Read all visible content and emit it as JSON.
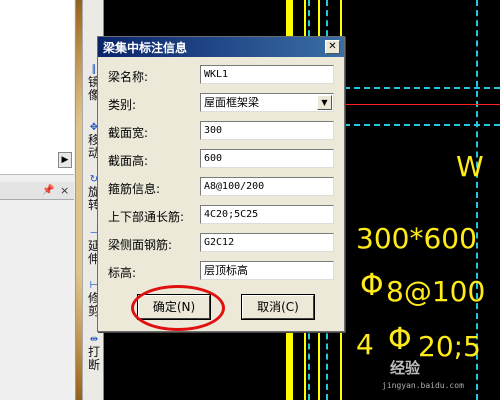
{
  "dialog": {
    "title": "梁集中标注信息",
    "close_label": "✕",
    "fields": [
      {
        "label": "梁名称:",
        "value": "WKL1"
      },
      {
        "label": "类别:",
        "value": "屋面框架梁"
      },
      {
        "label": "截面宽:",
        "value": "300"
      },
      {
        "label": "截面高:",
        "value": "600"
      },
      {
        "label": "箍筋信息:",
        "value": "A8@100/200"
      },
      {
        "label": "上下部通长筋:",
        "value": "4C20;5C25"
      },
      {
        "label": "梁侧面钢筋:",
        "value": "G2C12"
      },
      {
        "label": "标高:",
        "value": "层顶标高"
      }
    ],
    "ok_label": "确定(N)",
    "cancel_label": "取消(C)"
  },
  "toolbar": [
    {
      "icon": "mirror-icon",
      "label": "镜像"
    },
    {
      "icon": "move-icon",
      "label": "移动"
    },
    {
      "icon": "rotate-icon",
      "label": "旋转"
    },
    {
      "icon": "extend-icon",
      "label": "延伸"
    },
    {
      "icon": "trim-icon",
      "label": "修剪"
    },
    {
      "icon": "break-icon",
      "label": "打断"
    }
  ],
  "cad": {
    "texts": [
      "W",
      "300*600",
      "8@100",
      "4",
      "20;5"
    ],
    "colors": {
      "background": "#000000",
      "annotation": "#ffeb1a",
      "axis": "#ff2020",
      "dash": "#22c8e0"
    }
  },
  "watermark": {
    "brand": "经验",
    "url": "jingyan.baidu.com"
  },
  "colors": {
    "title_bar": "#0a246a",
    "highlight_ring": "#e01010",
    "dialog_bg": "#ece9d8"
  }
}
